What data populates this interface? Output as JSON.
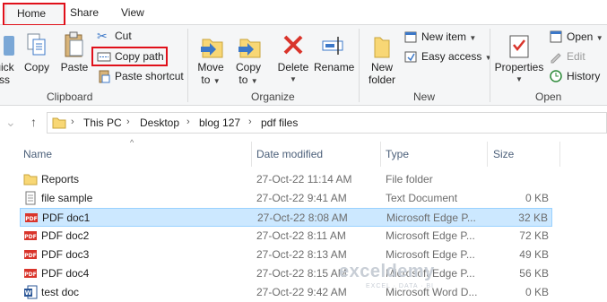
{
  "tabs": {
    "home": "Home",
    "share": "Share",
    "view": "View"
  },
  "ribbon": {
    "clipboard": {
      "label": "Clipboard",
      "quick_access_partial": "uick",
      "access_partial": "ss",
      "copy": "Copy",
      "paste": "Paste",
      "cut": "Cut",
      "copy_path": "Copy path",
      "paste_shortcut": "Paste shortcut"
    },
    "organize": {
      "label": "Organize",
      "move_to": "Move",
      "move_to2": "to",
      "copy_to": "Copy",
      "copy_to2": "to",
      "delete": "Delete",
      "rename": "Rename"
    },
    "new": {
      "label": "New",
      "new_folder": "New",
      "new_folder2": "folder",
      "new_item": "New item",
      "easy_access": "Easy access"
    },
    "open": {
      "label": "Open",
      "properties": "Properties",
      "open": "Open",
      "edit": "Edit",
      "history": "History"
    }
  },
  "address": {
    "crumbs": [
      "This PC",
      "Desktop",
      "blog 127",
      "pdf files"
    ]
  },
  "columns": {
    "name": "Name",
    "date": "Date modified",
    "type": "Type",
    "size": "Size"
  },
  "files": [
    {
      "name": "Reports",
      "date": "27-Oct-22 11:14 AM",
      "type": "File folder",
      "size": "",
      "icon": "folder-icon"
    },
    {
      "name": "file sample",
      "date": "27-Oct-22 9:41 AM",
      "type": "Text Document",
      "size": "0 KB",
      "icon": "text-file-icon"
    },
    {
      "name": "PDF doc1",
      "date": "27-Oct-22 8:08 AM",
      "type": "Microsoft Edge P...",
      "size": "32 KB",
      "icon": "pdf-icon",
      "selected": true
    },
    {
      "name": "PDF doc2",
      "date": "27-Oct-22 8:11 AM",
      "type": "Microsoft Edge P...",
      "size": "72 KB",
      "icon": "pdf-icon"
    },
    {
      "name": "PDF doc3",
      "date": "27-Oct-22 8:13 AM",
      "type": "Microsoft Edge P...",
      "size": "49 KB",
      "icon": "pdf-icon"
    },
    {
      "name": "PDF doc4",
      "date": "27-Oct-22 8:15 AM",
      "type": "Microsoft Edge P...",
      "size": "56 KB",
      "icon": "pdf-icon"
    },
    {
      "name": "test doc",
      "date": "27-Oct-22 9:42 AM",
      "type": "Microsoft Word D...",
      "size": "0 KB",
      "icon": "word-doc-icon"
    }
  ],
  "watermark": {
    "brand": "exceldemy",
    "tagline": "EXCEL · DATA · BI"
  },
  "colors": {
    "highlight": "#e0101a",
    "selection": "#cce8ff",
    "folder": "#f8d775",
    "pdf": "#d9342b",
    "word": "#2b5797"
  }
}
